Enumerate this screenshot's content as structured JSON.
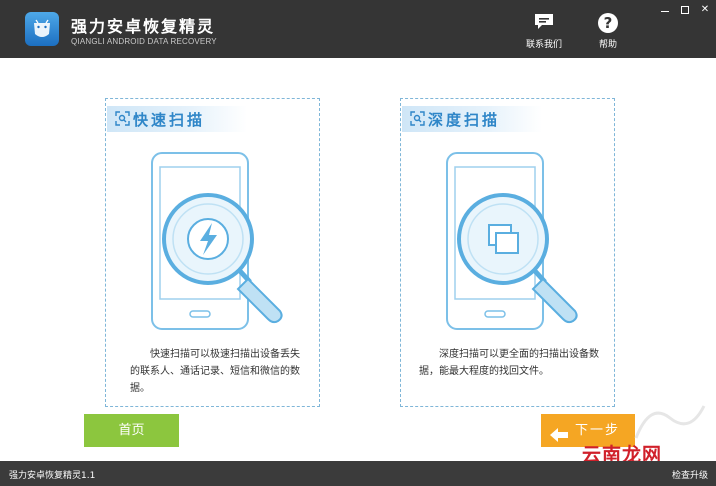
{
  "app": {
    "title": "强力安卓恢复精灵",
    "subtitle": "QIANGLI ANDROID DATA RECOVERY",
    "logo_icon": "android-shield-logo"
  },
  "header_actions": [
    {
      "label": "联系我们",
      "icon": "chat-icon"
    },
    {
      "label": "帮助",
      "icon": "question-icon"
    }
  ],
  "window_controls": [
    "minimize",
    "maximize",
    "close"
  ],
  "cards": [
    {
      "title": "快速扫描",
      "icon": "scan-frame-icon",
      "illustration": "phone-magnifier-lightning",
      "description": "快速扫描可以极速扫描出设备丢失的联系人、通话记录、短信和微信的数据。"
    },
    {
      "title": "深度扫描",
      "icon": "scan-frame-icon",
      "illustration": "phone-magnifier-layers",
      "description": "深度扫描可以更全面的扫描出设备数据，能最大程度的找回文件。"
    }
  ],
  "buttons": {
    "home": "首页",
    "next": "下一步"
  },
  "status": {
    "version": "强力安卓恢复精灵1.1",
    "update": "检查升级"
  },
  "watermark": "云南龙网",
  "colors": {
    "titlebar": "#353535",
    "accent": "#2f86c8",
    "home_button": "#8cc63e",
    "next_button": "#f5a623",
    "statusbar": "#3b3b3b"
  }
}
